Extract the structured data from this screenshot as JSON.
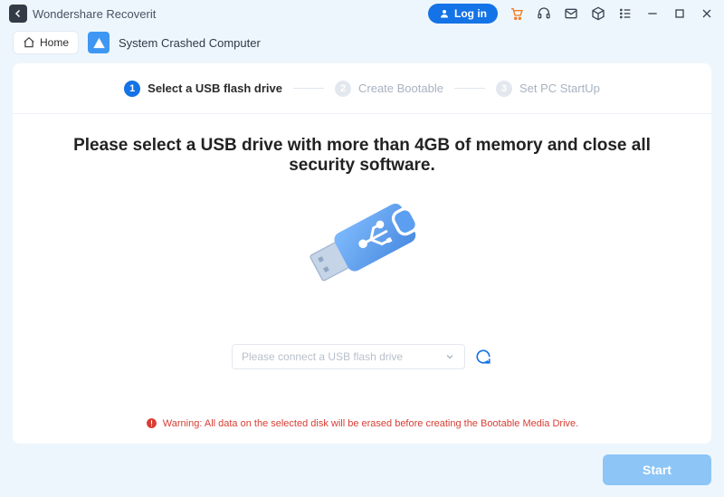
{
  "titlebar": {
    "app_title": "Wondershare Recoverit",
    "login": "Log in"
  },
  "breadcrumb": {
    "home": "Home",
    "page": "System Crashed Computer"
  },
  "stepper": {
    "steps": [
      {
        "num": "1",
        "label": "Select a USB flash drive",
        "active": true
      },
      {
        "num": "2",
        "label": "Create Bootable",
        "active": false
      },
      {
        "num": "3",
        "label": "Set PC StartUp",
        "active": false
      }
    ]
  },
  "main": {
    "instruction": "Please select a USB drive with more than 4GB of memory and close all security software.",
    "drive_placeholder": "Please connect a USB flash drive",
    "warning": "Warning: All data on the selected disk will be erased before creating the Bootable Media Drive."
  },
  "footer": {
    "start": "Start"
  }
}
